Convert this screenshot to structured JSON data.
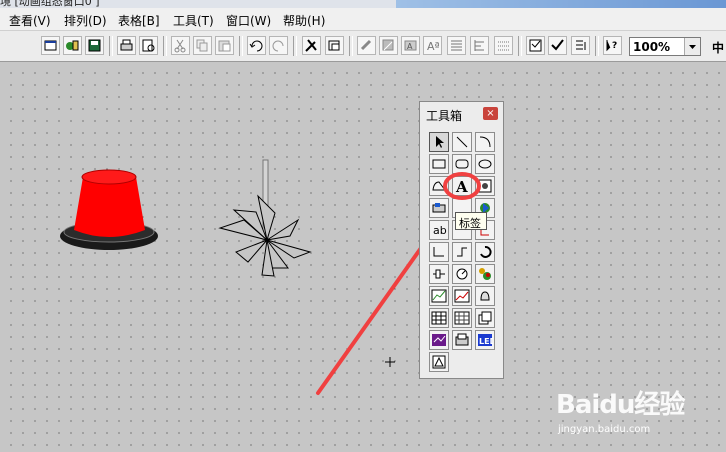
{
  "window": {
    "title_fragment": "境  [动画组态窗口0 ]"
  },
  "menubar": {
    "items": [
      "查看(V)",
      "排列(D)",
      "表格[B]",
      "工具(T)",
      "窗口(W)",
      "帮助(H)"
    ]
  },
  "toolbar": {
    "zoom_value": "100%",
    "trailing_label": "中"
  },
  "toolbox": {
    "title": "工具箱",
    "close_label": "×",
    "tooltip": "标签"
  },
  "watermark": {
    "brand": "Baidu经验",
    "url": "jingyan.baidu.com"
  },
  "colors": {
    "canvas_bg": "#c6c6c6",
    "lamp_red": "#ff0000",
    "annotation_red": "#f04040",
    "toolbox_close": "#c9433b"
  }
}
